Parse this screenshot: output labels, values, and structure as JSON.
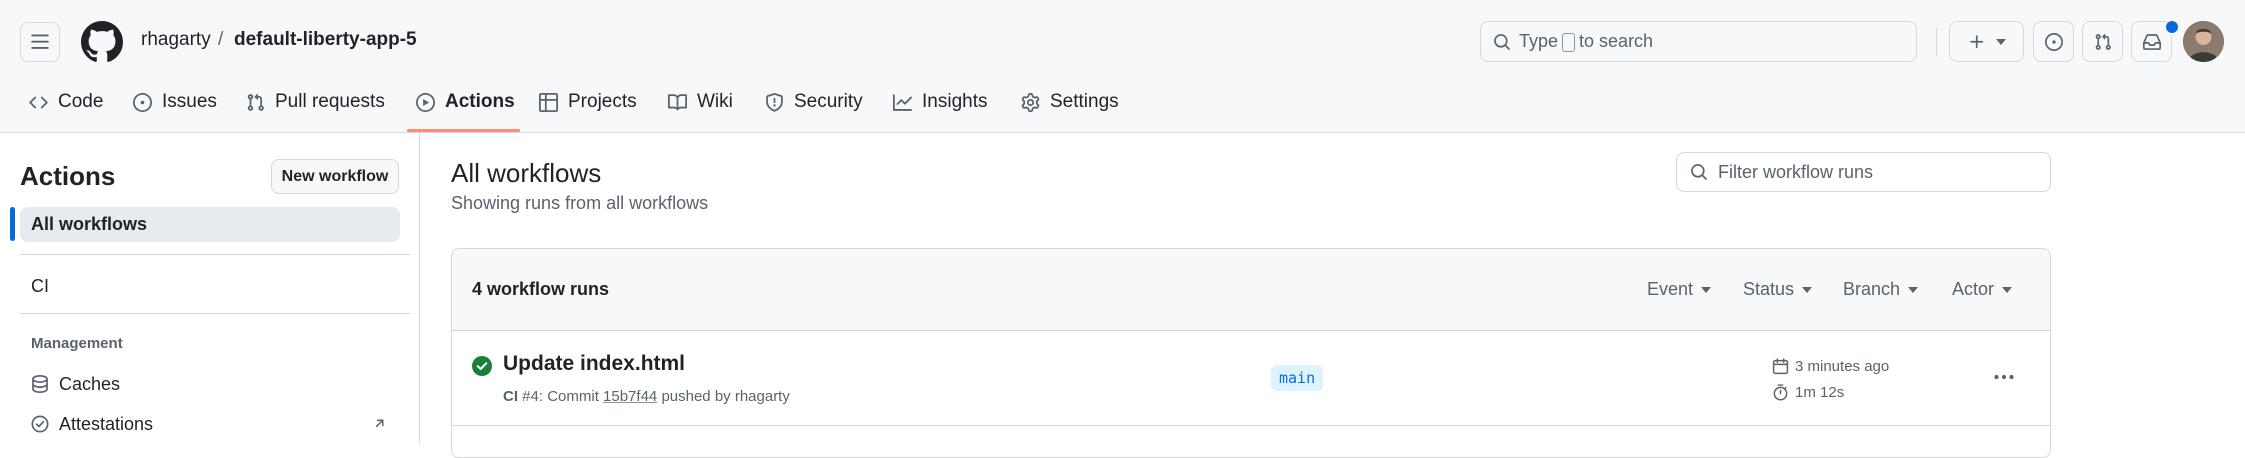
{
  "header": {
    "owner": "rhagarty",
    "separator": "/",
    "repo": "default-liberty-app-5",
    "search_before": "Type",
    "search_after": "to search",
    "icons": [
      "menu-icon",
      "github-logo-icon",
      "search-icon",
      "plus-icon",
      "issues-icon",
      "pull-request-icon",
      "inbox-icon"
    ],
    "notification_color": "#0969da"
  },
  "nav": {
    "tabs": [
      {
        "label": "Code",
        "icon": "code-icon"
      },
      {
        "label": "Issues",
        "icon": "issue-opened-icon"
      },
      {
        "label": "Pull requests",
        "icon": "git-pull-request-icon"
      },
      {
        "label": "Actions",
        "icon": "play-icon",
        "active": true
      },
      {
        "label": "Projects",
        "icon": "table-icon"
      },
      {
        "label": "Wiki",
        "icon": "book-icon"
      },
      {
        "label": "Security",
        "icon": "shield-icon"
      },
      {
        "label": "Insights",
        "icon": "graph-icon"
      },
      {
        "label": "Settings",
        "icon": "gear-icon"
      }
    ],
    "active_color": "#fd8c73"
  },
  "sidebar": {
    "title": "Actions",
    "new_workflow": "New workflow",
    "all_workflows": "All workflows",
    "workflows": [
      "CI"
    ],
    "management_heading": "Management",
    "management_items": [
      {
        "label": "Caches",
        "icon": "database-icon"
      },
      {
        "label": "Attestations",
        "icon": "verified-icon"
      }
    ]
  },
  "main": {
    "title": "All workflows",
    "subtitle": "Showing runs from all workflows",
    "filter_placeholder": "Filter workflow runs",
    "runs_count": "4 workflow runs",
    "filters": [
      "Event",
      "Status",
      "Branch",
      "Actor"
    ],
    "runs": [
      {
        "title": "Update index.html",
        "status": "success",
        "status_color": "#1a7f37",
        "workflow": "CI",
        "meta_run": "#4: Commit",
        "commit": "15b7f44",
        "meta_tail": "pushed by rhagarty",
        "branch": "main",
        "time_ago": "3 minutes ago",
        "duration": "1m 12s"
      }
    ]
  }
}
